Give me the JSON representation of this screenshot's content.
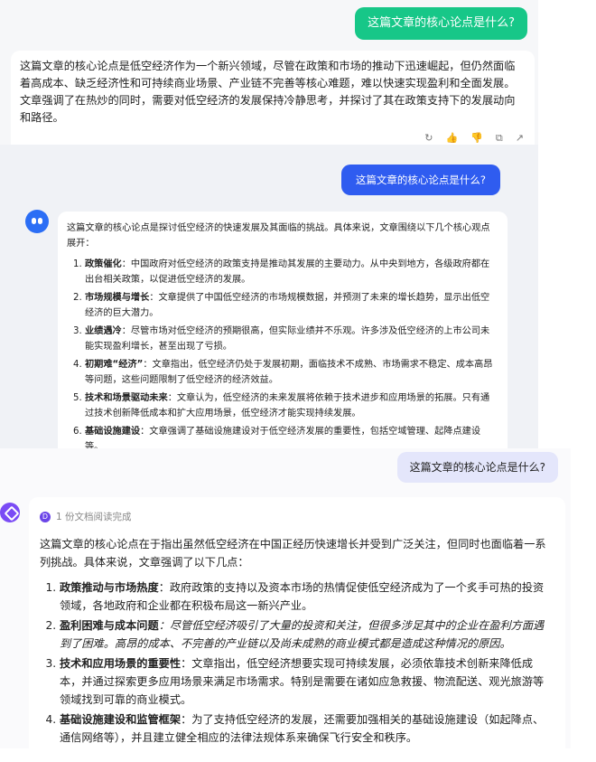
{
  "panel1": {
    "question": "这篇文章的核心论点是什么?",
    "answer": "这篇文章的核心论点是低空经济作为一个新兴领域，尽管在政策和市场的推动下迅速崛起，但仍然面临着高成本、缺乏经济性和可持续商业场景、产业链不完善等核心难题，难以快速实现盈利和全面发展。文章强调了在热炒的同时，需要对低空经济的发展保持冷静思考，并探讨了其在政策支持下的发展动向和路径。",
    "actions": [
      "refresh-icon",
      "thumbs-up-icon",
      "thumbs-down-icon",
      "copy-icon",
      "share-icon"
    ]
  },
  "panel2": {
    "question": "这篇文章的核心论点是什么?",
    "intro": "这篇文章的核心论点是探讨低空经济的快速发展及其面临的挑战。具体来说，文章围绕以下几个核心观点展开：",
    "points": [
      {
        "title": "政策催化",
        "text": "：中国政府对低空经济的政策支持是推动其发展的主要动力。从中央到地方，各级政府都在出台相关政策，以促进低空经济的发展。"
      },
      {
        "title": "市场规模与增长",
        "text": "：文章提供了中国低空经济的市场规模数据，并预测了未来的增长趋势，显示出低空经济的巨大潜力。"
      },
      {
        "title": "业绩遇冷",
        "text": "：尽管市场对低空经济的预期很高，但实际业绩并不乐观。许多涉及低空经济的上市公司未能实现盈利增长，甚至出现了亏损。"
      },
      {
        "title": "初期难“经济”",
        "text": "：文章指出，低空经济仍处于发展初期，面临技术不成熟、市场需求不稳定、成本高昂等问题，这些问题限制了低空经济的经济效益。"
      },
      {
        "title": "技术和场景驱动未来",
        "text": "：文章认为，低空经济的未来发展将依赖于技术进步和应用场景的拓展。只有通过技术创新降低成本和扩大应用场景，低空经济才能实现持续发展。"
      },
      {
        "title": "基础设施建设",
        "text": "：文章强调了基础设施建设对于低空经济发展的重要性，包括空域管理、起降点建设等。"
      }
    ]
  },
  "panel3": {
    "question": "这篇文章的核心论点是什么?",
    "status": "1 份文档阅读完成",
    "intro": "这篇文章的核心论点在于指出虽然低空经济在中国正经历快速增长并受到广泛关注，但同时也面临着一系列挑战。具体来说，文章强调了以下几点：",
    "points": [
      {
        "title": "政策推动与市场热度",
        "text": "：政府政策的支持以及资本市场的热情促使低空经济成为了一个炙手可热的投资领域，各地政府和企业都在积极布局这一新兴产业。"
      },
      {
        "title": "盈利困难与成本问题",
        "text": "：尽管低空经济吸引了大量的投资和关注，但很多涉足其中的企业在盈利方面遇到了困难。高昂的成本、不完善的产业链以及尚未成熟的商业模式都是造成这种情况的原因。"
      },
      {
        "title": "技术和应用场景的重要性",
        "text": "：文章指出，低空经济想要实现可持续发展，必须依靠技术创新来降低成本，并通过探索更多应用场景来满足市场需求。特别是需要在诸如应急救援、物流配送、观光旅游等领域找到可靠的商业模式。"
      },
      {
        "title": "基础设施建设和监管框架",
        "text": "：为了支持低空经济的发展，还需要加强相关的基础设施建设（如起降点、通信网络等），并且建立健全相应的法律法规体系来确保飞行安全和秩序。"
      }
    ]
  }
}
